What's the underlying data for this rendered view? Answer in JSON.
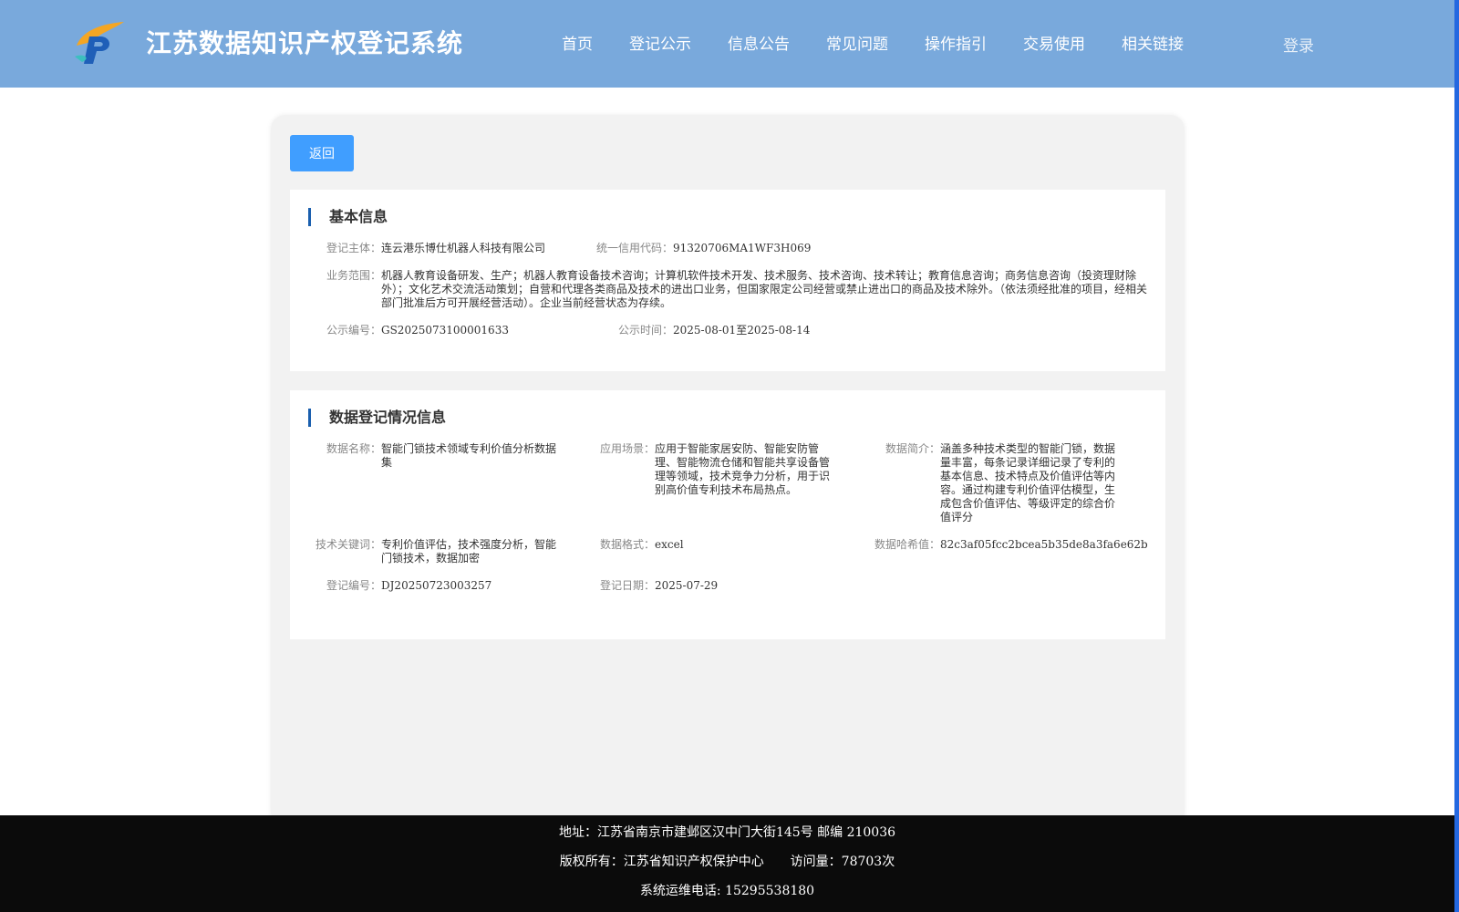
{
  "header": {
    "title": "江苏数据知识产权登记系统",
    "nav": [
      "首页",
      "登记公示",
      "信息公告",
      "常见问题",
      "操作指引",
      "交易使用",
      "相关链接"
    ],
    "login": "登录"
  },
  "back_button": "返回",
  "basic_info": {
    "heading": "基本信息",
    "subject_label": "登记主体：",
    "subject": "连云港乐博仕机器人科技有限公司",
    "credit_code_label": "统一信用代码：",
    "credit_code": "91320706MA1WF3H069",
    "scope_label": "业务范围：",
    "scope": "机器人教育设备研发、生产；机器人教育设备技术咨询；计算机软件技术开发、技术服务、技术咨询、技术转让；教育信息咨询；商务信息咨询（投资理财除外）；文化艺术交流活动策划；自营和代理各类商品及技术的进出口业务，但国家限定公司经营或禁止进出口的商品及技术除外。（依法须经批准的项目，经相关部门批准后方可开展经营活动）。企业当前经营状态为存续。",
    "notice_no_label": "公示编号：",
    "notice_no": "GS2025073100001633",
    "notice_time_label": "公示时间：",
    "notice_time": "2025-08-01至2025-08-14"
  },
  "data_info": {
    "heading": "数据登记情况信息",
    "name_label": "数据名称：",
    "name": "智能门锁技术领域专利价值分析数据集",
    "scene_label": "应用场景：",
    "scene": "应用于智能家居安防、智能安防管理、智能物流仓储和智能共享设备管理等领域，技术竞争力分析，用于识别高价值专利技术布局热点。",
    "intro_label": "数据简介：",
    "intro": "涵盖多种技术类型的智能门锁，数据量丰富，每条记录详细记录了专利的基本信息、技术特点及价值评估等内容。通过构建专利价值评估模型，生成包含价值评估、等级评定的综合价值评分",
    "keywords_label": "技术关键词：",
    "keywords": "专利价值评估，技术强度分析，智能门锁技术，数据加密",
    "format_label": "数据格式：",
    "format": "excel",
    "hash_label": "数据哈希值：",
    "hash": "82c3af05fcc2bcea5b35de8a3fa6e62b",
    "reg_no_label": "登记编号：",
    "reg_no": "DJ20250723003257",
    "reg_date_label": "登记日期：",
    "reg_date": "2025-07-29"
  },
  "footer": {
    "address": "地址：江苏省南京市建邺区汉中门大街145号 邮编 210036",
    "copyright": "版权所有：江苏省知识产权保护中心",
    "visits": "访问量：78703次",
    "phone": "系统运维电话: 15295538180"
  }
}
